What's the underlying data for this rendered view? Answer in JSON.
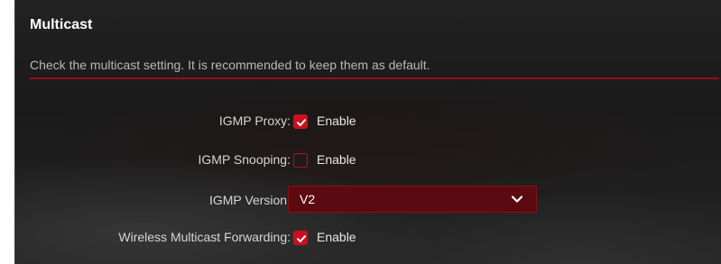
{
  "section": {
    "title": "Multicast",
    "description": "Check the multicast setting. It is recommended to keep them as default."
  },
  "settings": {
    "igmp_proxy": {
      "label": "IGMP Proxy:",
      "option_label": "Enable",
      "checked": true
    },
    "igmp_snooping": {
      "label": "IGMP Snooping:",
      "option_label": "Enable",
      "checked": false
    },
    "igmp_version": {
      "label": "IGMP Version:",
      "selected": "V2"
    },
    "wireless_multicast_forwarding": {
      "label": "Wireless Multicast Forwarding:",
      "option_label": "Enable",
      "checked": true
    }
  },
  "icons": {
    "checkmark": "checkmark-icon",
    "dropdown": "chevron-down-icon"
  },
  "colors": {
    "accent": "#c8101e",
    "divider": "#9b0d18",
    "select_background": "#5a0a10",
    "panel_background": "#1e1e1e"
  }
}
